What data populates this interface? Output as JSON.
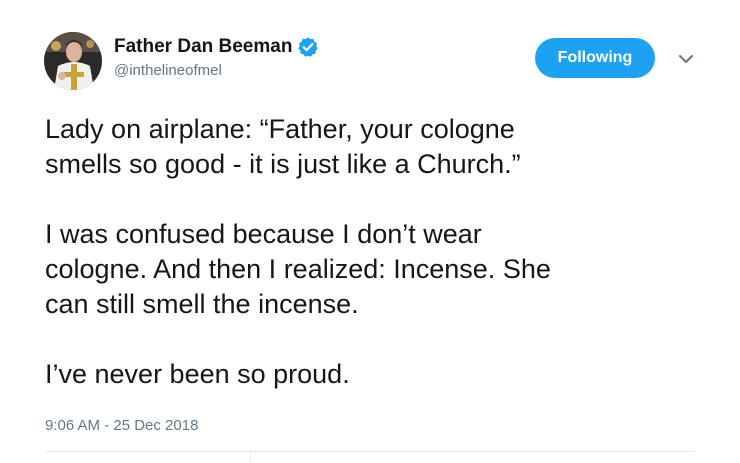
{
  "author": {
    "display_name": "Father Dan Beeman",
    "handle": "@inthelineofmel",
    "verified": true,
    "verified_color": "#1da1f2"
  },
  "follow_button": {
    "label": "Following",
    "color": "#1da1f2"
  },
  "menu_icon": "chevron-down-icon",
  "tweet": {
    "paragraphs": [
      "Lady on airplane:  “Father, your cologne\nsmells so good - it is just  like a Church.”",
      "I was confused because I don’t wear\ncologne. And then I realized: Incense. She\ncan still smell the incense.",
      "I’ve never been so proud."
    ],
    "timestamp": "9:06 AM - 25 Dec 2018"
  }
}
